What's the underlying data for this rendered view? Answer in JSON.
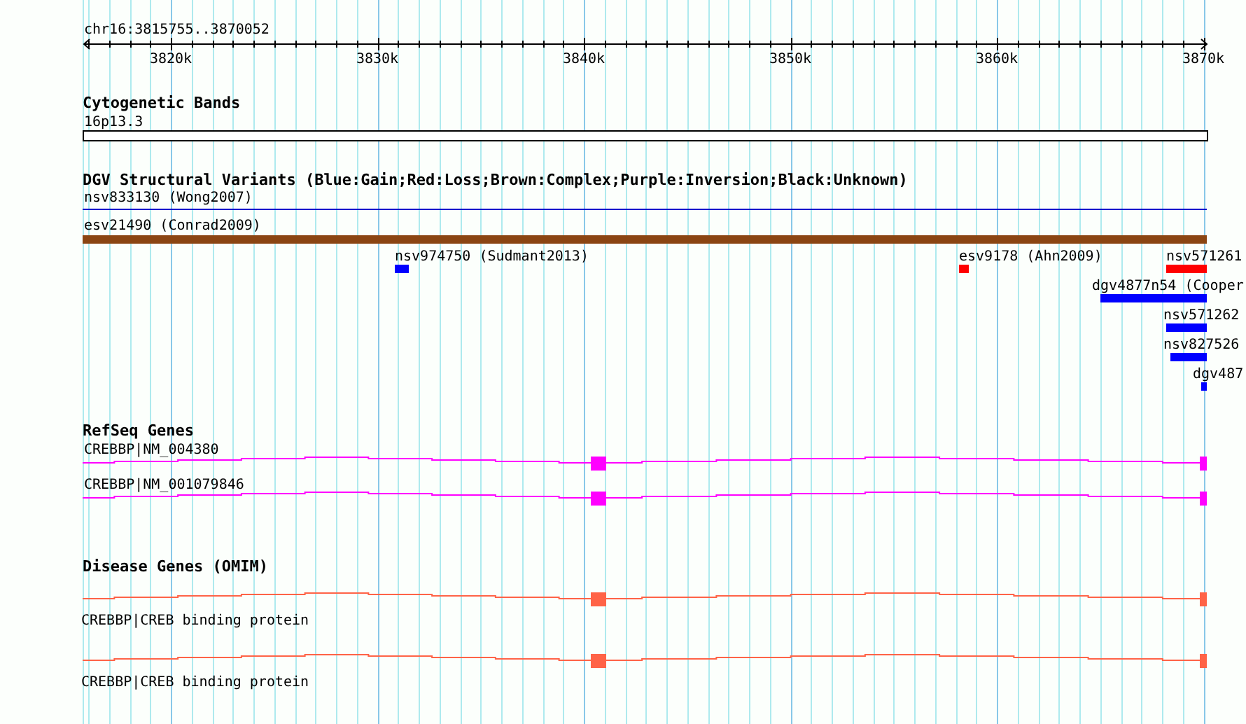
{
  "ruler": {
    "region": "chr16:3815755..3870052",
    "ticks": [
      "3820k",
      "3830k",
      "3840k",
      "3850k",
      "3860k",
      "3870k"
    ]
  },
  "tracks": [
    {
      "kind": "cytoband",
      "title": "Cytogenetic Bands",
      "features": [
        {
          "label": "16p13.3"
        }
      ]
    },
    {
      "kind": "variants",
      "title": "DGV Structural Variants (Blue:Gain;Red:Loss;Brown:Complex;Purple:Inversion;Black:Unknown)",
      "features": [
        {
          "label": "nsv833130 (Wong2007)",
          "kind": "line",
          "color": "#0000cc"
        },
        {
          "label": "esv21490 (Conrad2009)",
          "kind": "bar",
          "color": "#8b4513"
        },
        {
          "label": "nsv974750 (Sudmant2013)",
          "kind": "bar",
          "color": "#0000ff"
        },
        {
          "label": "esv9178 (Ahn2009)",
          "kind": "bar",
          "color": "#ff0000"
        },
        {
          "label": "nsv571261",
          "kind": "bar",
          "color": "#ff0000"
        },
        {
          "label": "dgv4877n54 (Cooper",
          "kind": "bar",
          "color": "#0000ff"
        },
        {
          "label": "nsv571262",
          "kind": "bar",
          "color": "#0000ff"
        },
        {
          "label": "nsv827526",
          "kind": "bar",
          "color": "#0000ff"
        },
        {
          "label": "dgv487",
          "kind": "bar",
          "color": "#0000ff"
        }
      ]
    },
    {
      "kind": "refseq",
      "title": "RefSeq Genes",
      "features": [
        {
          "label": "CREBBP|NM_004380"
        },
        {
          "label": "CREBBP|NM_001079846"
        }
      ]
    },
    {
      "kind": "omim",
      "title": "Disease Genes (OMIM)",
      "features": [
        {
          "label": "CREBBP|CREB binding protein"
        },
        {
          "label": "CREBBP|CREB binding protein"
        }
      ]
    }
  ]
}
